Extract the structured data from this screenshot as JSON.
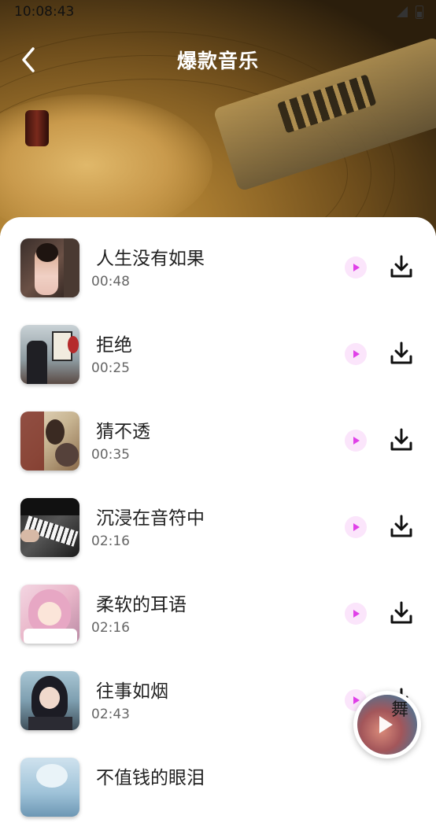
{
  "status": {
    "time": "10:08:43"
  },
  "header": {
    "title": "爆款音乐"
  },
  "songs": [
    {
      "title": "人生没有如果",
      "duration": "00:48"
    },
    {
      "title": "拒绝",
      "duration": "00:25"
    },
    {
      "title": "猜不透",
      "duration": "00:35"
    },
    {
      "title": "沉浸在音符中",
      "duration": "02:16"
    },
    {
      "title": "柔软的耳语",
      "duration": "02:16"
    },
    {
      "title": "往事如烟",
      "duration": "02:43"
    },
    {
      "title": "不值钱的眼泪",
      "duration": ""
    }
  ],
  "floating_player": {
    "glyph": "舞"
  },
  "colors": {
    "accent": "#e040e8",
    "play_bg": "#fbe5fb"
  },
  "icons": {
    "back": "chevron-left-icon",
    "play": "play-icon",
    "download": "download-icon"
  }
}
